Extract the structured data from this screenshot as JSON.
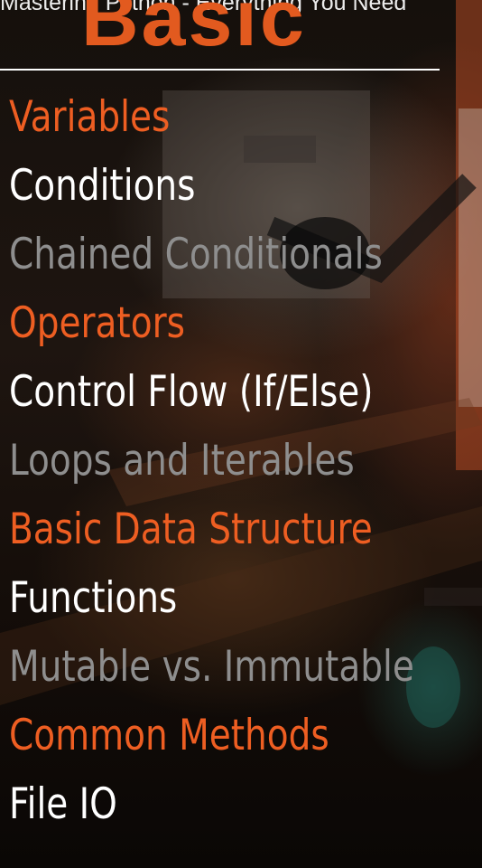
{
  "video": {
    "title": "Mastering Python - Everything You Need"
  },
  "heading": "Basic",
  "topics": [
    {
      "label": "Variables",
      "color": "#ee5e22"
    },
    {
      "label": "Conditions",
      "color": "#ffffff"
    },
    {
      "label": "Chained Conditionals",
      "color": "#8e8e8e"
    },
    {
      "label": "Operators",
      "color": "#ee5e22"
    },
    {
      "label": "Control Flow (If/Else)",
      "color": "#ffffff"
    },
    {
      "label": "Loops and Iterables",
      "color": "#8e8e8e"
    },
    {
      "label": "Basic Data Structure",
      "color": "#ee5e22"
    },
    {
      "label": "Functions",
      "color": "#ffffff"
    },
    {
      "label": "Mutable vs. Immutable",
      "color": "#8e8e8e"
    },
    {
      "label": "Common Methods",
      "color": "#ee5e22"
    },
    {
      "label": "File IO",
      "color": "#ffffff"
    }
  ],
  "colors": {
    "accent": "#e25a1f",
    "primary_text": "#ffffff",
    "muted_text": "#8e8e8e"
  }
}
